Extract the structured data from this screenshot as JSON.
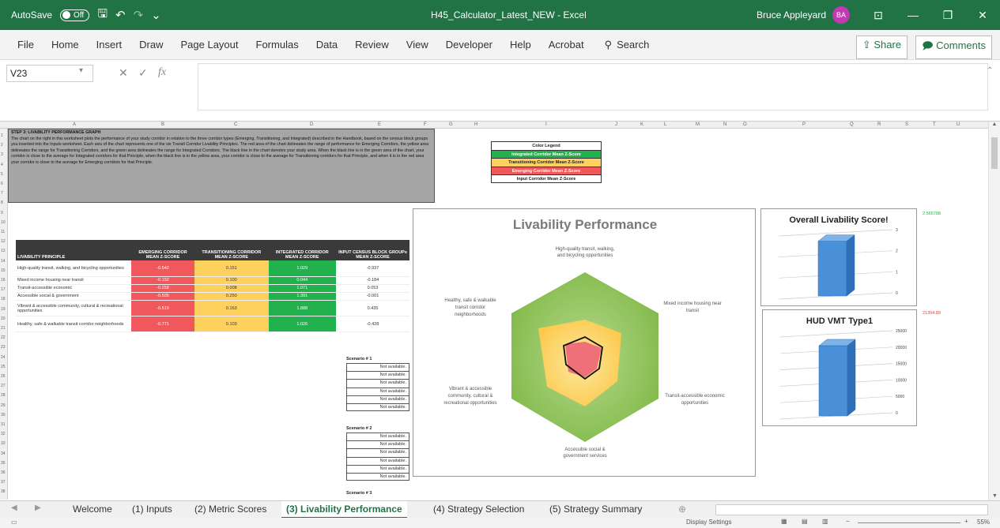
{
  "titlebar": {
    "autosave_label": "AutoSave",
    "autosave_state": "Off",
    "doc_title": "H45_Calculator_Latest_NEW - Excel",
    "user_name": "Bruce Appleyard",
    "user_initials": "BA"
  },
  "menu": {
    "items": [
      "File",
      "Home",
      "Insert",
      "Draw",
      "Page Layout",
      "Formulas",
      "Data",
      "Review",
      "View",
      "Developer",
      "Help",
      "Acrobat"
    ],
    "search_label": "Search",
    "share_label": "Share",
    "comments_label": "Comments"
  },
  "formula_bar": {
    "name_box": "V23",
    "fx_label": "fx",
    "formula": ""
  },
  "columns": [
    "A",
    "B",
    "C",
    "D",
    "E",
    "F",
    "G",
    "H",
    "I",
    "J",
    "K",
    "L",
    "M",
    "N",
    "O",
    "P",
    "Q",
    "R",
    "S",
    "T",
    "U"
  ],
  "rows": [
    "1",
    "2",
    "3",
    "4",
    "5",
    "6",
    "7",
    "8",
    "9",
    "10",
    "11",
    "12",
    "13",
    "14",
    "15",
    "16",
    "17",
    "18",
    "19",
    "20",
    "21",
    "22",
    "23",
    "24",
    "25",
    "26",
    "27",
    "28",
    "29",
    "30",
    "31",
    "32",
    "33",
    "34",
    "35",
    "36",
    "37",
    "38"
  ],
  "step3": {
    "heading": "STEP 3: LIVABILITY PERFORMANCE GRAPH",
    "body": "The chart on the right in this worksheet plots the performance of your study corridor in relation to the three corridor types (Emerging, Transitioning, and Integrated) described in the Handbook, based on the census block groups you inserted into the Inputs worksheet. Each axis of the chart represents one of the six Transit Corridor Livability Principles. The red area of the chart delineates the range of performance for Emerging Corridors, the yellow area delineates the range for Transitioning Corridors, and the green area delineates the range for Integrated Corridors. The black line in the chart denotes your study area. When the black line is in the green area of the chart, your corridor is close to the average for Integrated corridors for that Principle, when the black line is in the yellow area, your corridor is close to the average for Transitioning corridors for that Principle, and when it is in the red area your corridor is close to the average for Emerging corridors for that Principle."
  },
  "legend": {
    "title": "Color Legend",
    "items": [
      {
        "label": "Integrated Corridor Mean Z-Score",
        "color": "#22b14c"
      },
      {
        "label": "Transitioning Corridor Mean Z-Score",
        "color": "#fed15e"
      },
      {
        "label": "Emerging Corridor Mean Z-Score",
        "color": "#f0585d"
      },
      {
        "label": "Input Corridor Mean Z-Score",
        "color": "#ffffff"
      }
    ]
  },
  "ztable": {
    "headers": [
      "LIVABILITY PRINCIPLE",
      "EMERGING CORRIDOR MEAN Z-SCORE",
      "TRANSITIONING CORRIDOR MEAN Z-SCORE",
      "INTEGRATED CORRIDOR MEAN Z-SCORE",
      "INPUT CENSUS BLOCK GROUPs MEAN Z-SCORE"
    ],
    "rows": [
      [
        "High-quality transit, walking, and bicycling opportunities",
        "-0.542",
        "0.151",
        "1.029",
        "-0.937"
      ],
      [
        "Mixed income housing near transit",
        "-0.152",
        "0.100",
        "0.044",
        "-0.184"
      ],
      [
        "Transit-accessible economic",
        "-0.258",
        "0.008",
        "1.071",
        "0.053"
      ],
      [
        "Accessible social & government",
        "-0.505",
        "0.250",
        "1.391",
        "-0.001"
      ],
      [
        "Vibrant & accessible community, cultural & recreational opportunities",
        "-0.519",
        "0.163",
        "1.888",
        "0.435"
      ],
      [
        "Healthy, safe & walkable transit corridor neighborhoods",
        "-0.771",
        "0.103",
        "1.026",
        "-0.428"
      ]
    ]
  },
  "scenarios": [
    {
      "title": "Scenario # 1",
      "cells": [
        "Not available.",
        "Not available.",
        "Not available.",
        "Not available.",
        "Not available.",
        "Not available."
      ]
    },
    {
      "title": "Scenario # 2",
      "cells": [
        "Not available.",
        "Not available.",
        "Not available.",
        "Not available.",
        "Not available.",
        "Not available."
      ]
    },
    {
      "title": "Scenario # 3",
      "cells": []
    }
  ],
  "radar": {
    "title": "Livability Performance",
    "axes": [
      "High-quality transit, walking, and bicycling opportunities",
      "Mixed income housing near transit",
      "Transit-accessible economic opportunities",
      "Accessible social & government services",
      "Vibrant & accessible community, cultural & recreational opportunities",
      "Healthy, safe & walkable transit corridor neighborhoods"
    ],
    "colors": {
      "integrated": "#8dc35a",
      "transitioning": "#fed15e",
      "emerging": "#f0585d",
      "input": "#111111"
    }
  },
  "chart_data": [
    {
      "type": "bar",
      "title": "Overall Livability Score!",
      "categories": [
        ""
      ],
      "values": [
        2.6
      ],
      "ylim": [
        0,
        3
      ],
      "yticks": [
        "0",
        "1",
        "2",
        "3"
      ],
      "side_value": "2.565788"
    },
    {
      "type": "bar",
      "title": "HUD VMT Type1",
      "categories": [
        ""
      ],
      "values": [
        21394.89
      ],
      "ylim": [
        0,
        25000
      ],
      "yticks": [
        "0",
        "5000",
        "10000",
        "15000",
        "20000",
        "25000"
      ],
      "side_value": "21394.89"
    }
  ],
  "sheet_tabs": [
    "Welcome",
    "(1) Inputs",
    "(2) Metric Scores",
    "(3) Livability Performance",
    "(4) Strategy Selection",
    "(5) Strategy Summary"
  ],
  "active_tab": "(3) Livability Performance",
  "status": {
    "display_settings": "Display Settings",
    "zoom": "55%"
  }
}
